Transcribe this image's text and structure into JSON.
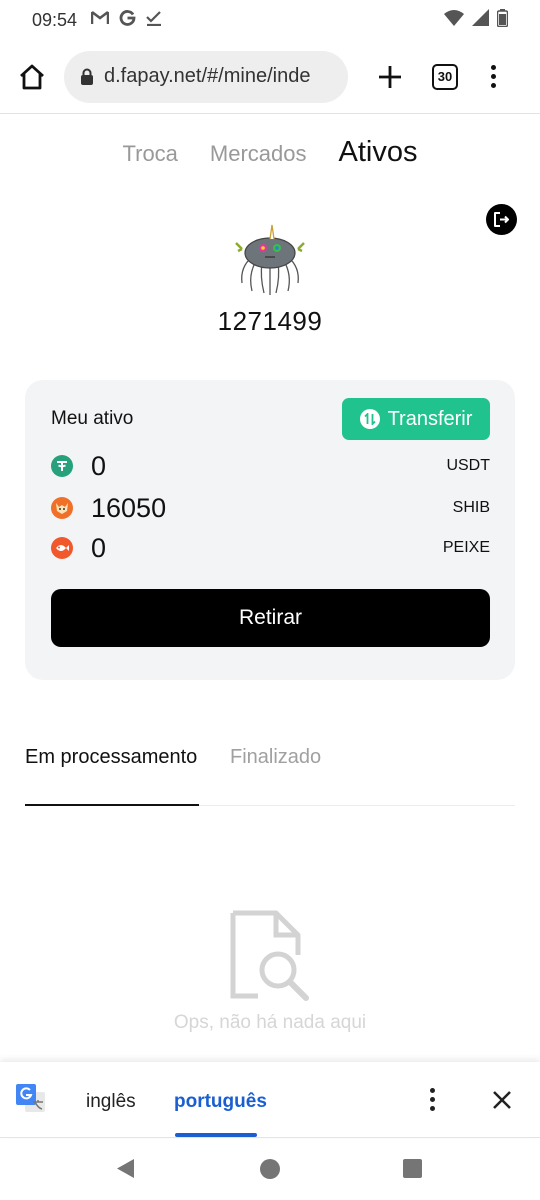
{
  "status_bar": {
    "time": "09:54",
    "icons": [
      "gmail-icon",
      "google-icon",
      "check-icon",
      "wifi-icon",
      "signal-icon",
      "battery-icon"
    ]
  },
  "browser": {
    "url": "d.fapay.net/#/mine/inde",
    "tab_count": "30"
  },
  "top_tabs": [
    {
      "label": "Troca",
      "active": false
    },
    {
      "label": "Mercados",
      "active": false
    },
    {
      "label": "Ativos",
      "active": true
    }
  ],
  "profile": {
    "user_id": "1271499"
  },
  "assets": {
    "title": "Meu ativo",
    "transfer_label": "Transferir",
    "withdraw_label": "Retirar",
    "rows": [
      {
        "amount": "0",
        "symbol": "USDT",
        "color": "#26a17b"
      },
      {
        "amount": "16050",
        "symbol": "SHIB",
        "color": "#f0702a"
      },
      {
        "amount": "0",
        "symbol": "PEIXE",
        "color": "#f1582c"
      }
    ]
  },
  "orders": {
    "tabs": [
      {
        "label": "Em processamento",
        "active": true
      },
      {
        "label": "Finalizado",
        "active": false
      }
    ],
    "empty_text": "Ops, não há nada aqui"
  },
  "translate_bar": {
    "source_lang": "inglês",
    "target_lang": "português"
  },
  "colors": {
    "accent_green": "#20c28e",
    "translate_blue": "#1a5fd1"
  }
}
